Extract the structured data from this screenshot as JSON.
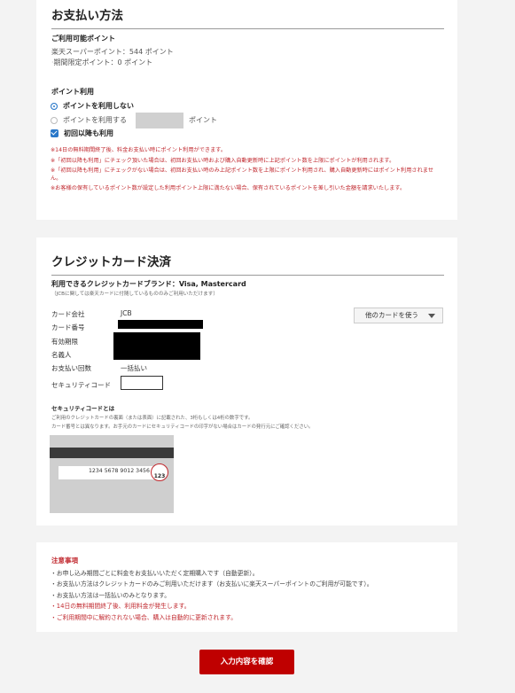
{
  "payment": {
    "title": "お支払い方法",
    "available_points_heading": "ご利用可能ポイント",
    "super_points": "楽天スーパーポイント：544 ポイント",
    "limited_points": "期間限定ポイント：0 ポイント",
    "point_usage_heading": "ポイント利用",
    "option_no_points": "ポイントを利用しない",
    "option_use_points": "ポイントを利用する",
    "points_unit": "ポイント",
    "points_input_placeholder": "",
    "checkbox_label": "初回以降も利用",
    "notes": [
      "※14日の無料期間終了後、料金お支払い時にポイント利用ができます。",
      "※「初回以降も利用」にチェック頂いた場合は、初回お支払い時および購入自動更新時に上記ポイント数を上限にポイントが利用されます。",
      "※「初回以降も利用」にチェックがない場合は、初回お支払い時のみ上記ポイント数を上限にポイント利用され、購入自動更新時にはポイント利用されません。",
      "※お客様の保有しているポイント数が設定した利用ポイント上限に満たない場合、保有されているポイントを差し引いた金額を請求いたします。"
    ]
  },
  "credit": {
    "title": "クレジットカード決済",
    "brands": "利用できるクレジットカードブランド：Visa, Mastercard",
    "brands_note": "（JCBに関しては楽天カードに付随しているもののみご利用いただけます）",
    "labels": {
      "company": "カード会社",
      "number": "カード番号",
      "expiry": "有効期限",
      "holder": "名義人",
      "installments": "お支払い回数",
      "security_code": "セキュリティコード"
    },
    "values": {
      "company": "JCB",
      "installments": "一括払い"
    },
    "other_card_button": "他のカードを使う",
    "security_heading": "セキュリティコードとは",
    "security_desc_1": "ご利用のクレジットカードの裏面（または表面）に記載された、3桁もしくは4桁の数字です。",
    "security_desc_2": "カード番号とは異なります。お手元のカードにセキュリティコードの印字がない場合はカードの発行元にご確認ください。",
    "card_sample_number": "1234 5678 9012 3456",
    "card_sample_code": "123"
  },
  "notice": {
    "title": "注意事項",
    "items": [
      "・お申し込み期間ごとに料金をお支払いいただく定期購入です（自動更新）。",
      "・お支払い方法はクレジットカードのみご利用いただけます（お支払いに楽天スーパーポイントのご利用が可能です）。",
      "・お支払い方法は一括払いのみとなります。",
      "・14日の無料期間終了後、利用料金が発生します。",
      "・ご利用期間中に解約されない場合、購入は自動的に更新されます。"
    ],
    "red_item_index": 3
  },
  "confirm_button": "入力内容を確認",
  "colors": {
    "accent_red": "#bf0000",
    "radio_blue": "#2a78c9",
    "note_red": "#c0272d"
  }
}
